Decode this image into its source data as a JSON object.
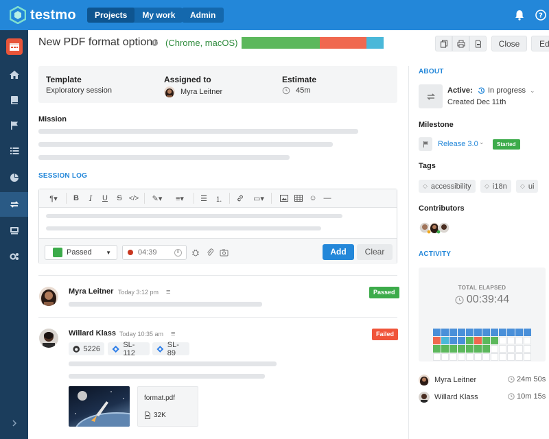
{
  "app": {
    "name": "testmo"
  },
  "nav": {
    "projects": "Projects",
    "mywork": "My work",
    "admin": "Admin"
  },
  "header": {
    "title": "New PDF format options",
    "environment": "(Chrome, macOS)",
    "status_segments": [
      {
        "color": "#5cb85c",
        "fraction": 0.55
      },
      {
        "color": "#f0684f",
        "fraction": 0.33
      },
      {
        "color": "#4ab8d9",
        "fraction": 0.12
      }
    ],
    "close_label": "Close",
    "edit_label": "Edit"
  },
  "info": {
    "template_label": "Template",
    "template_value": "Exploratory session",
    "assigned_label": "Assigned to",
    "assigned_value": "Myra Leitner",
    "estimate_label": "Estimate",
    "estimate_value": "45m"
  },
  "mission_label": "Mission",
  "session_log_label": "SESSION LOG",
  "editor": {
    "status_value": "Passed",
    "status_color": "#3cab4a",
    "timer_placeholder": "04:39",
    "add_label": "Add",
    "clear_label": "Clear"
  },
  "log": [
    {
      "name": "Myra Leitner",
      "time": "Today 3:12 pm",
      "badge": "Passed",
      "badge_color": "#3cab4a"
    },
    {
      "name": "Willard Klass",
      "time": "Today 10:35 am",
      "badge": "Failed",
      "badge_color": "#f0543a",
      "links": [
        "5226",
        "SL-112",
        "SL-89"
      ],
      "file": {
        "name": "format.pdf",
        "size": "32K"
      }
    }
  ],
  "about": {
    "heading": "ABOUT",
    "active_label": "Active:",
    "state": "In progress",
    "created": "Created Dec 11th",
    "milestone_label": "Milestone",
    "milestone_value": "Release 3.0",
    "milestone_badge": "Started",
    "tags_label": "Tags",
    "tags": [
      "accessibility",
      "i18n",
      "ui"
    ],
    "contributors_label": "Contributors"
  },
  "activity": {
    "heading": "ACTIVITY",
    "elapsed_label": "TOTAL ELAPSED",
    "elapsed_value": "00:39:44",
    "entries": [
      {
        "name": "Myra Leitner",
        "time": "24m 50s"
      },
      {
        "name": "Willard Klass",
        "time": "10m 15s"
      }
    ]
  },
  "colors": {
    "brand": "#2387d9",
    "sidebar": "#1b3d5c",
    "passed": "#5cb85c",
    "failed": "#f0684f",
    "info": "#4a90d9"
  }
}
